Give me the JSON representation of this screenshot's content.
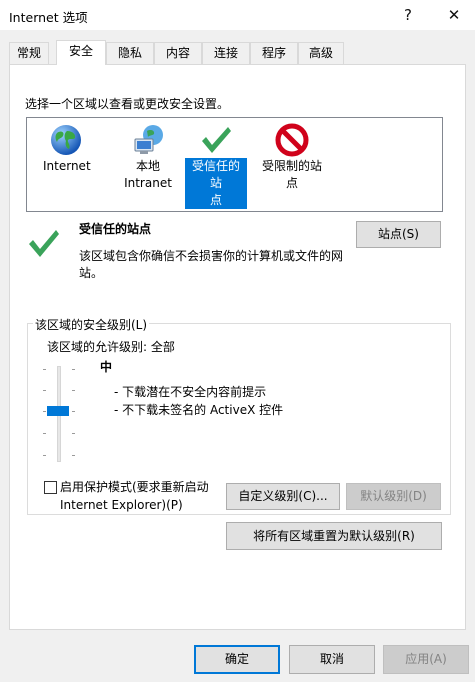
{
  "window": {
    "title": "Internet 选项",
    "help_label": "?",
    "close_label": "✕"
  },
  "tabs": [
    {
      "label": "常规"
    },
    {
      "label": "安全",
      "active": true
    },
    {
      "label": "隐私"
    },
    {
      "label": "内容"
    },
    {
      "label": "连接"
    },
    {
      "label": "程序"
    },
    {
      "label": "高级"
    }
  ],
  "security": {
    "zone_prompt": "选择一个区域以查看或更改安全设置。",
    "zones": [
      {
        "line1": "Internet",
        "line2": "",
        "icon": "globe-icon"
      },
      {
        "line1": "本地",
        "line2": "Intranet",
        "icon": "intranet-icon"
      },
      {
        "line1": "受信任的站",
        "line2": "点",
        "icon": "checkmark-icon",
        "selected": true
      },
      {
        "line1": "受限制的站",
        "line2": "点",
        "icon": "restricted-icon"
      }
    ],
    "trusted_title": "受信任的站点",
    "trusted_desc": "该区域包含你确信不会损害你的计算机或文件的网站。",
    "sites_button": "站点(S)",
    "group_label": "该区域的安全级别(L)",
    "allowed_levels": "该区域的允许级别: 全部",
    "level_name": "中",
    "level_lines": [
      "- 下载潜在不安全内容前提示",
      "- 不下载未签名的 ActiveX 控件"
    ],
    "slider_level": 0.5,
    "protected_mode_line1": "启用保护模式(要求重新启动",
    "protected_mode_line2": "Internet Explorer)(P)",
    "protected_mode_checked": false,
    "custom_level_button": "自定义级别(C)...",
    "default_level_button": "默认级别(D)",
    "reset_all_button": "将所有区域重置为默认级别(R)"
  },
  "footer": {
    "ok": "确定",
    "cancel": "取消",
    "apply": "应用(A)"
  },
  "colors": {
    "accent": "#0078d7",
    "check_green": "#3aa35a",
    "restricted_red": "#d0021b"
  }
}
